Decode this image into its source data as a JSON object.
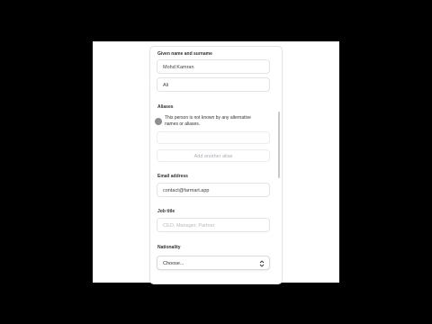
{
  "form": {
    "name_label": "Given name and surname",
    "given_name": "Mohd Kamran",
    "surname": "Ali",
    "aliases_label": "Aliases",
    "no_alias_text": "This person is not known by any alternative names or aliases.",
    "add_alias_label": "Add another alias",
    "email_label": "Email address",
    "email_value": "contact@farmart.app",
    "job_title_label": "Job title",
    "job_title_placeholder": "CEO, Manager, Partner",
    "nationality_label": "Nationality",
    "nationality_value": "Choose..."
  },
  "icons": {
    "select_arrows": "chevron-up-down-icon",
    "radio": "radio-icon"
  },
  "colors": {
    "background": "#000000",
    "card": "#ffffff",
    "border": "#e3e3e7",
    "placeholder": "#b8b8bf"
  }
}
